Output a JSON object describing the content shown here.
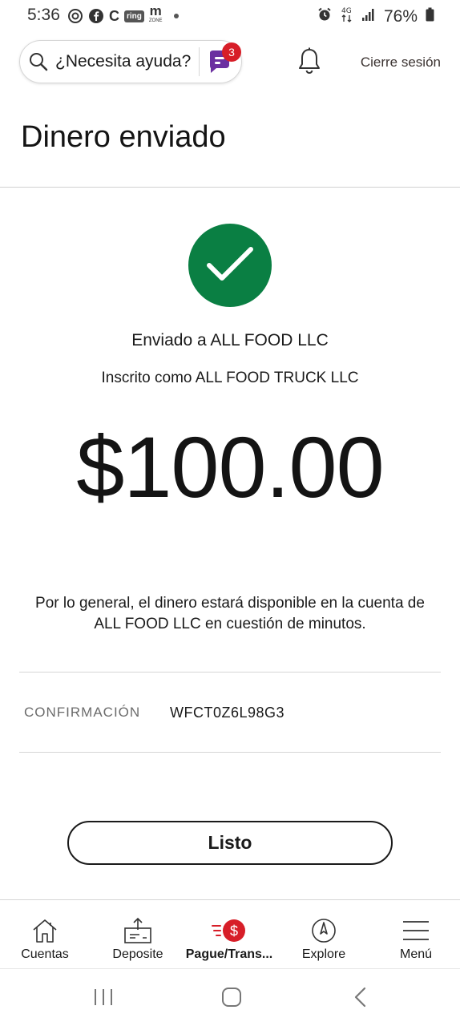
{
  "status_bar": {
    "time": "5:36",
    "battery": "76%",
    "left_icons": [
      "threads-icon",
      "facebook-icon",
      "c-app-icon",
      "ring-icon",
      "m-zone-icon",
      "dot-icon"
    ],
    "ring_text": "ring",
    "m_text": "m",
    "zone_text": "ZONE",
    "c_text": "C",
    "right_icons": [
      "alarm-icon",
      "data-4g-icon",
      "signal-icon",
      "battery-icon"
    ]
  },
  "header": {
    "help_text": "¿Necesita ayuda?",
    "chat_badge": "3",
    "sign_out": "Cierre sesión"
  },
  "page_title": "Dinero enviado",
  "confirmation_panel": {
    "sent_to": "Enviado a ALL FOOD LLC",
    "enrolled_as": "Inscrito como ALL FOOD TRUCK LLC",
    "amount": "$100.00",
    "availability_note": "Por lo general, el dinero estará disponible en la cuenta de ALL FOOD LLC en cuestión de minutos.",
    "confirmation_label": "CONFIRMACIÓN",
    "confirmation_number": "WFCT0Z6L98G3",
    "done_label": "Listo"
  },
  "bottom_nav": {
    "items": [
      {
        "label": "Cuentas",
        "icon": "house-icon"
      },
      {
        "label": "Deposite",
        "icon": "deposit-icon"
      },
      {
        "label": "Pague/Trans...",
        "icon": "pay-transfer-icon",
        "active": true
      },
      {
        "label": "Explore",
        "icon": "compass-icon"
      },
      {
        "label": "Menú",
        "icon": "hamburger-icon"
      }
    ]
  },
  "android_nav": [
    "recents-icon",
    "home-icon",
    "back-icon"
  ],
  "colors": {
    "success_green": "#0a7f43",
    "brand_red": "#d71e28",
    "chat_purple": "#6b2fa0",
    "text_dark": "#141414",
    "divider": "#d6d6d6"
  }
}
